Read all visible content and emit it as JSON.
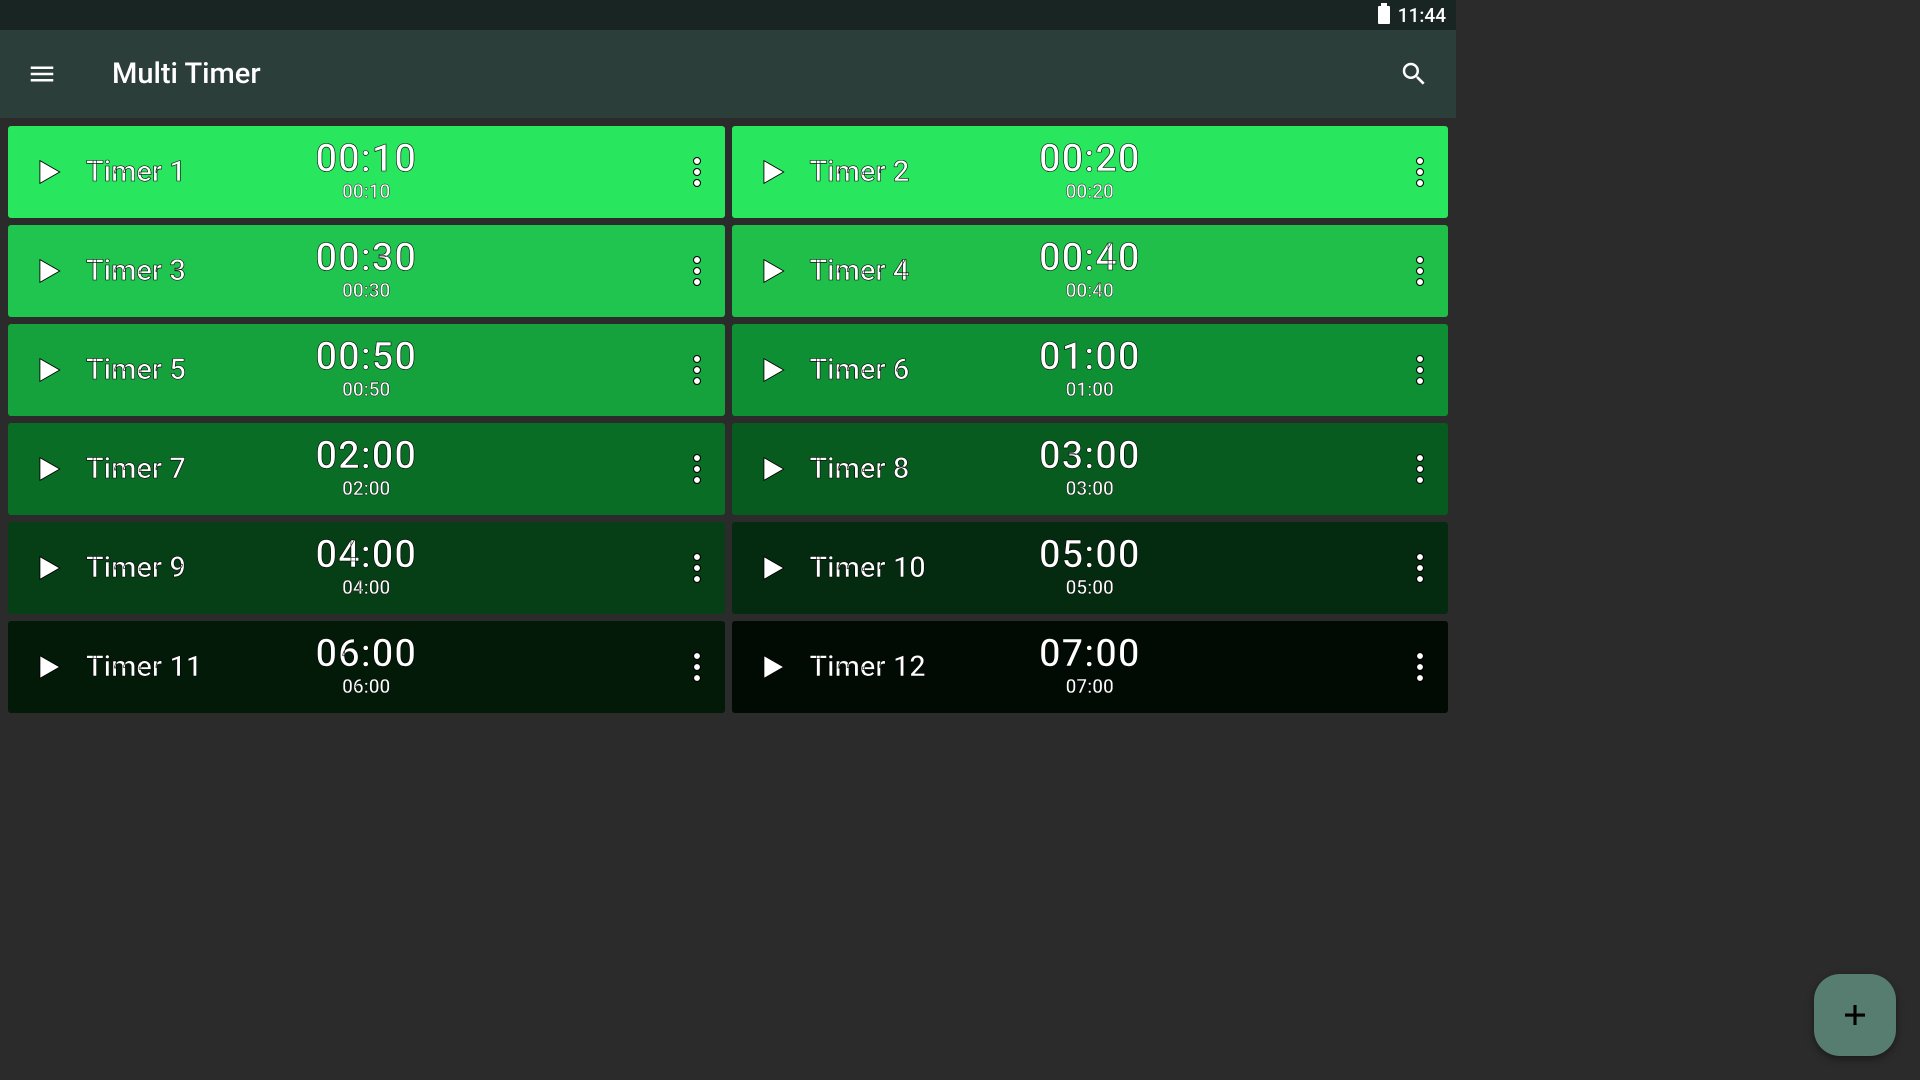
{
  "status": {
    "time": "11:44"
  },
  "header": {
    "title": "Multi Timer"
  },
  "colors": [
    "#28e65e",
    "#28e65e",
    "#1fc54e",
    "#1fbf4a",
    "#15a13b",
    "#0f8f33",
    "#0a6d26",
    "#085b1f",
    "#063e16",
    "#042b0f",
    "#031a09",
    "#010a03"
  ],
  "timers": [
    {
      "name": "Timer 1",
      "big": "00:10",
      "small": "00:10"
    },
    {
      "name": "Timer 2",
      "big": "00:20",
      "small": "00:20"
    },
    {
      "name": "Timer 3",
      "big": "00:30",
      "small": "00:30"
    },
    {
      "name": "Timer 4",
      "big": "00:40",
      "small": "00:40"
    },
    {
      "name": "Timer 5",
      "big": "00:50",
      "small": "00:50"
    },
    {
      "name": "Timer 6",
      "big": "01:00",
      "small": "01:00"
    },
    {
      "name": "Timer 7",
      "big": "02:00",
      "small": "02:00"
    },
    {
      "name": "Timer 8",
      "big": "03:00",
      "small": "03:00"
    },
    {
      "name": "Timer 9",
      "big": "04:00",
      "small": "04:00"
    },
    {
      "name": "Timer 10",
      "big": "05:00",
      "small": "05:00"
    },
    {
      "name": "Timer 11",
      "big": "06:00",
      "small": "06:00"
    },
    {
      "name": "Timer 12",
      "big": "07:00",
      "small": "07:00"
    }
  ]
}
